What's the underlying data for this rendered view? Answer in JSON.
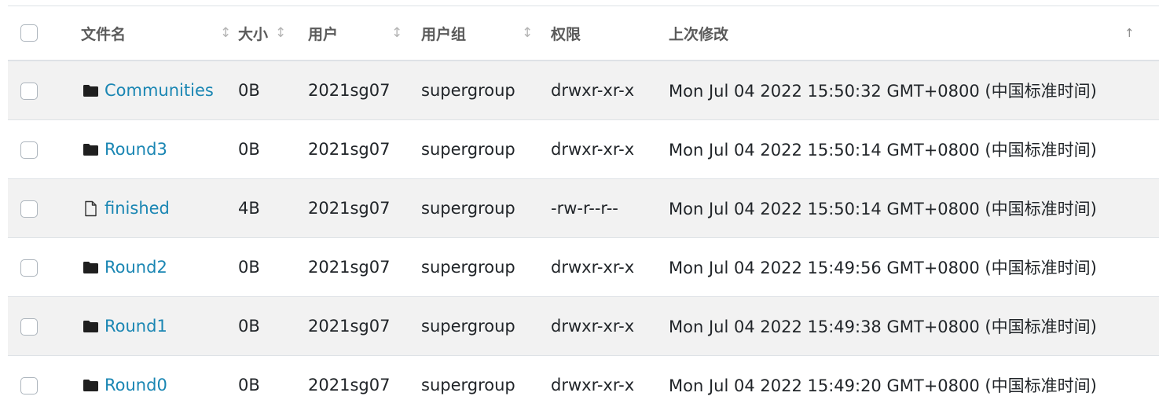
{
  "table": {
    "headers": {
      "name": "文件名",
      "size": "大小",
      "user": "用户",
      "group": "用户组",
      "perm": "权限",
      "modified": "上次修改"
    },
    "sort_icons": {
      "neutral": "↕",
      "ascending": "↑"
    },
    "rows": [
      {
        "type": "folder",
        "icon": "folder-icon",
        "name": "Communities",
        "size": "0B",
        "user": "2021sg07",
        "group": "supergroup",
        "perm": "drwxr-xr-x",
        "modified": "Mon Jul 04 2022 15:50:32 GMT+0800 (中国标准时间)"
      },
      {
        "type": "folder",
        "icon": "folder-icon",
        "name": "Round3",
        "size": "0B",
        "user": "2021sg07",
        "group": "supergroup",
        "perm": "drwxr-xr-x",
        "modified": "Mon Jul 04 2022 15:50:14 GMT+0800 (中国标准时间)"
      },
      {
        "type": "file",
        "icon": "file-icon",
        "name": "finished",
        "size": "4B",
        "user": "2021sg07",
        "group": "supergroup",
        "perm": "-rw-r--r--",
        "modified": "Mon Jul 04 2022 15:50:14 GMT+0800 (中国标准时间)"
      },
      {
        "type": "folder",
        "icon": "folder-icon",
        "name": "Round2",
        "size": "0B",
        "user": "2021sg07",
        "group": "supergroup",
        "perm": "drwxr-xr-x",
        "modified": "Mon Jul 04 2022 15:49:56 GMT+0800 (中国标准时间)"
      },
      {
        "type": "folder",
        "icon": "folder-icon",
        "name": "Round1",
        "size": "0B",
        "user": "2021sg07",
        "group": "supergroup",
        "perm": "drwxr-xr-x",
        "modified": "Mon Jul 04 2022 15:49:38 GMT+0800 (中国标准时间)"
      },
      {
        "type": "folder",
        "icon": "folder-icon",
        "name": "Round0",
        "size": "0B",
        "user": "2021sg07",
        "group": "supergroup",
        "perm": "drwxr-xr-x",
        "modified": "Mon Jul 04 2022 15:49:20 GMT+0800 (中国标准时间)"
      }
    ]
  },
  "colors": {
    "link": "#1a86b3",
    "stripe": "#f2f2f2",
    "header_text": "#5a5a5a"
  }
}
